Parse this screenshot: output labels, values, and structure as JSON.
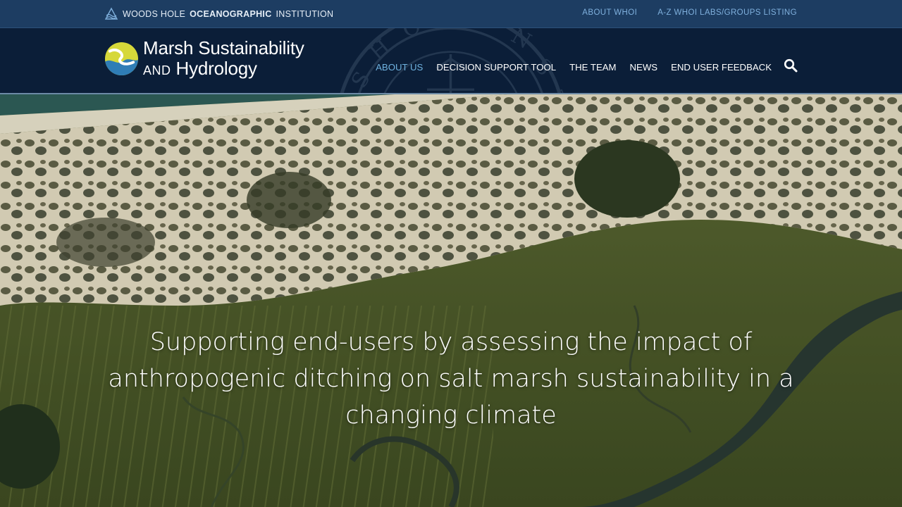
{
  "topbar": {
    "brand_prefix": "WOODS HOLE",
    "brand_bold": "OCEANOGRAPHIC",
    "brand_suffix": "INSTITUTION",
    "links": [
      {
        "label": "ABOUT WHOI"
      },
      {
        "label": "A-Z WHOI LABS/GROUPS LISTING"
      }
    ]
  },
  "logo": {
    "line1": "Marsh Sustainability",
    "line2_small": "AND",
    "line2_rest": "Hydrology",
    "circle_colors": {
      "yellow": "#d6d83a",
      "blue": "#2f7db6"
    }
  },
  "nav": {
    "items": [
      {
        "label": "ABOUT US",
        "active": true
      },
      {
        "label": "DECISION SUPPORT TOOL",
        "active": false
      },
      {
        "label": "THE TEAM",
        "active": false
      },
      {
        "label": "NEWS",
        "active": false
      },
      {
        "label": "END USER FEEDBACK",
        "active": false
      }
    ],
    "search_icon": "search-icon"
  },
  "hero": {
    "line1": "Supporting end-users by assessing the impact of",
    "line2": "anthropogenic ditching on salt marsh sustainability in a",
    "line3": "changing climate"
  },
  "colors": {
    "topbar_bg": "#1d3d62",
    "mainbar_bg": "#0b1e38",
    "accent": "#6fb2df",
    "marsh": "#4f5e2a",
    "dune": "#e3dcc2"
  }
}
